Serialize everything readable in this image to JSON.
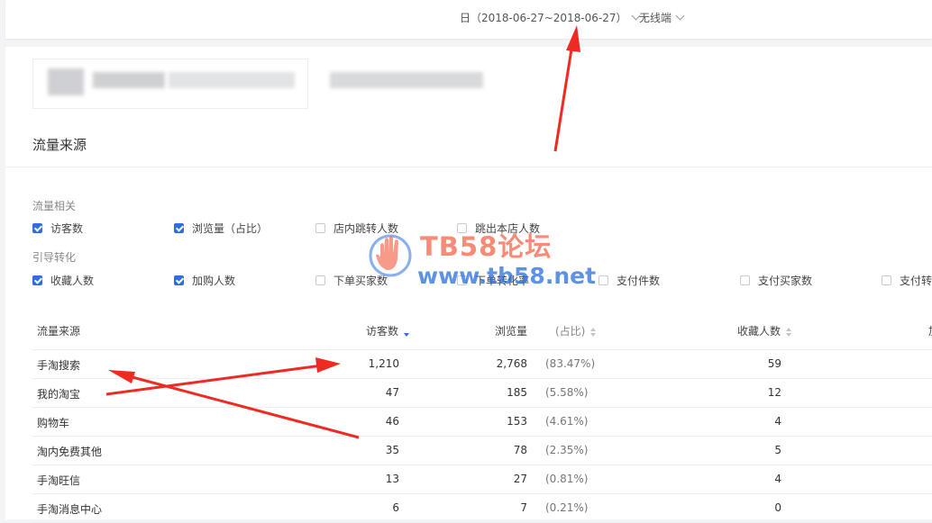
{
  "header": {
    "date_filter": "日（2018-06-27~2018-06-27）",
    "device_filter": "无线端"
  },
  "section_title": "流量来源",
  "filters": {
    "group1_label": "流量相关",
    "group1": [
      {
        "label": "访客数",
        "checked": true
      },
      {
        "label": "浏览量（占比）",
        "checked": true
      },
      {
        "label": "店内跳转人数",
        "checked": false
      },
      {
        "label": "跳出本店人数",
        "checked": false
      }
    ],
    "group2_label": "引导转化",
    "group2": [
      {
        "label": "收藏人数",
        "checked": true
      },
      {
        "label": "加购人数",
        "checked": true
      },
      {
        "label": "下单买家数",
        "checked": false
      },
      {
        "label": "下单转化率",
        "checked": false
      },
      {
        "label": "支付件数",
        "checked": false
      },
      {
        "label": "支付买家数",
        "checked": false
      },
      {
        "label": "支付转",
        "checked": false
      }
    ]
  },
  "table": {
    "columns": [
      "流量来源",
      "访客数",
      "浏览量",
      "(占比)",
      "收藏人数",
      "加"
    ],
    "rows": [
      {
        "source": "手淘搜索",
        "visitors": "1,210",
        "pv": "2,768",
        "share": "(83.47%)",
        "fav": "59"
      },
      {
        "source": "我的淘宝",
        "visitors": "47",
        "pv": "185",
        "share": "(5.58%)",
        "fav": "12"
      },
      {
        "source": "购物车",
        "visitors": "46",
        "pv": "153",
        "share": "(4.61%)",
        "fav": "4"
      },
      {
        "source": "淘内免费其他",
        "visitors": "35",
        "pv": "78",
        "share": "(2.35%)",
        "fav": "5"
      },
      {
        "source": "手淘旺信",
        "visitors": "13",
        "pv": "27",
        "share": "(0.81%)",
        "fav": "4"
      },
      {
        "source": "手淘消息中心",
        "visitors": "6",
        "pv": "7",
        "share": "(0.21%)",
        "fav": "0"
      }
    ]
  },
  "watermark": {
    "line1": "TB58论坛",
    "line2": "www.tb58.net"
  },
  "colors": {
    "accent": "#2f6fdb",
    "annotation_arrow": "#ee2a22",
    "watermark_red": "#f4644a",
    "watermark_blue": "#286edc"
  }
}
